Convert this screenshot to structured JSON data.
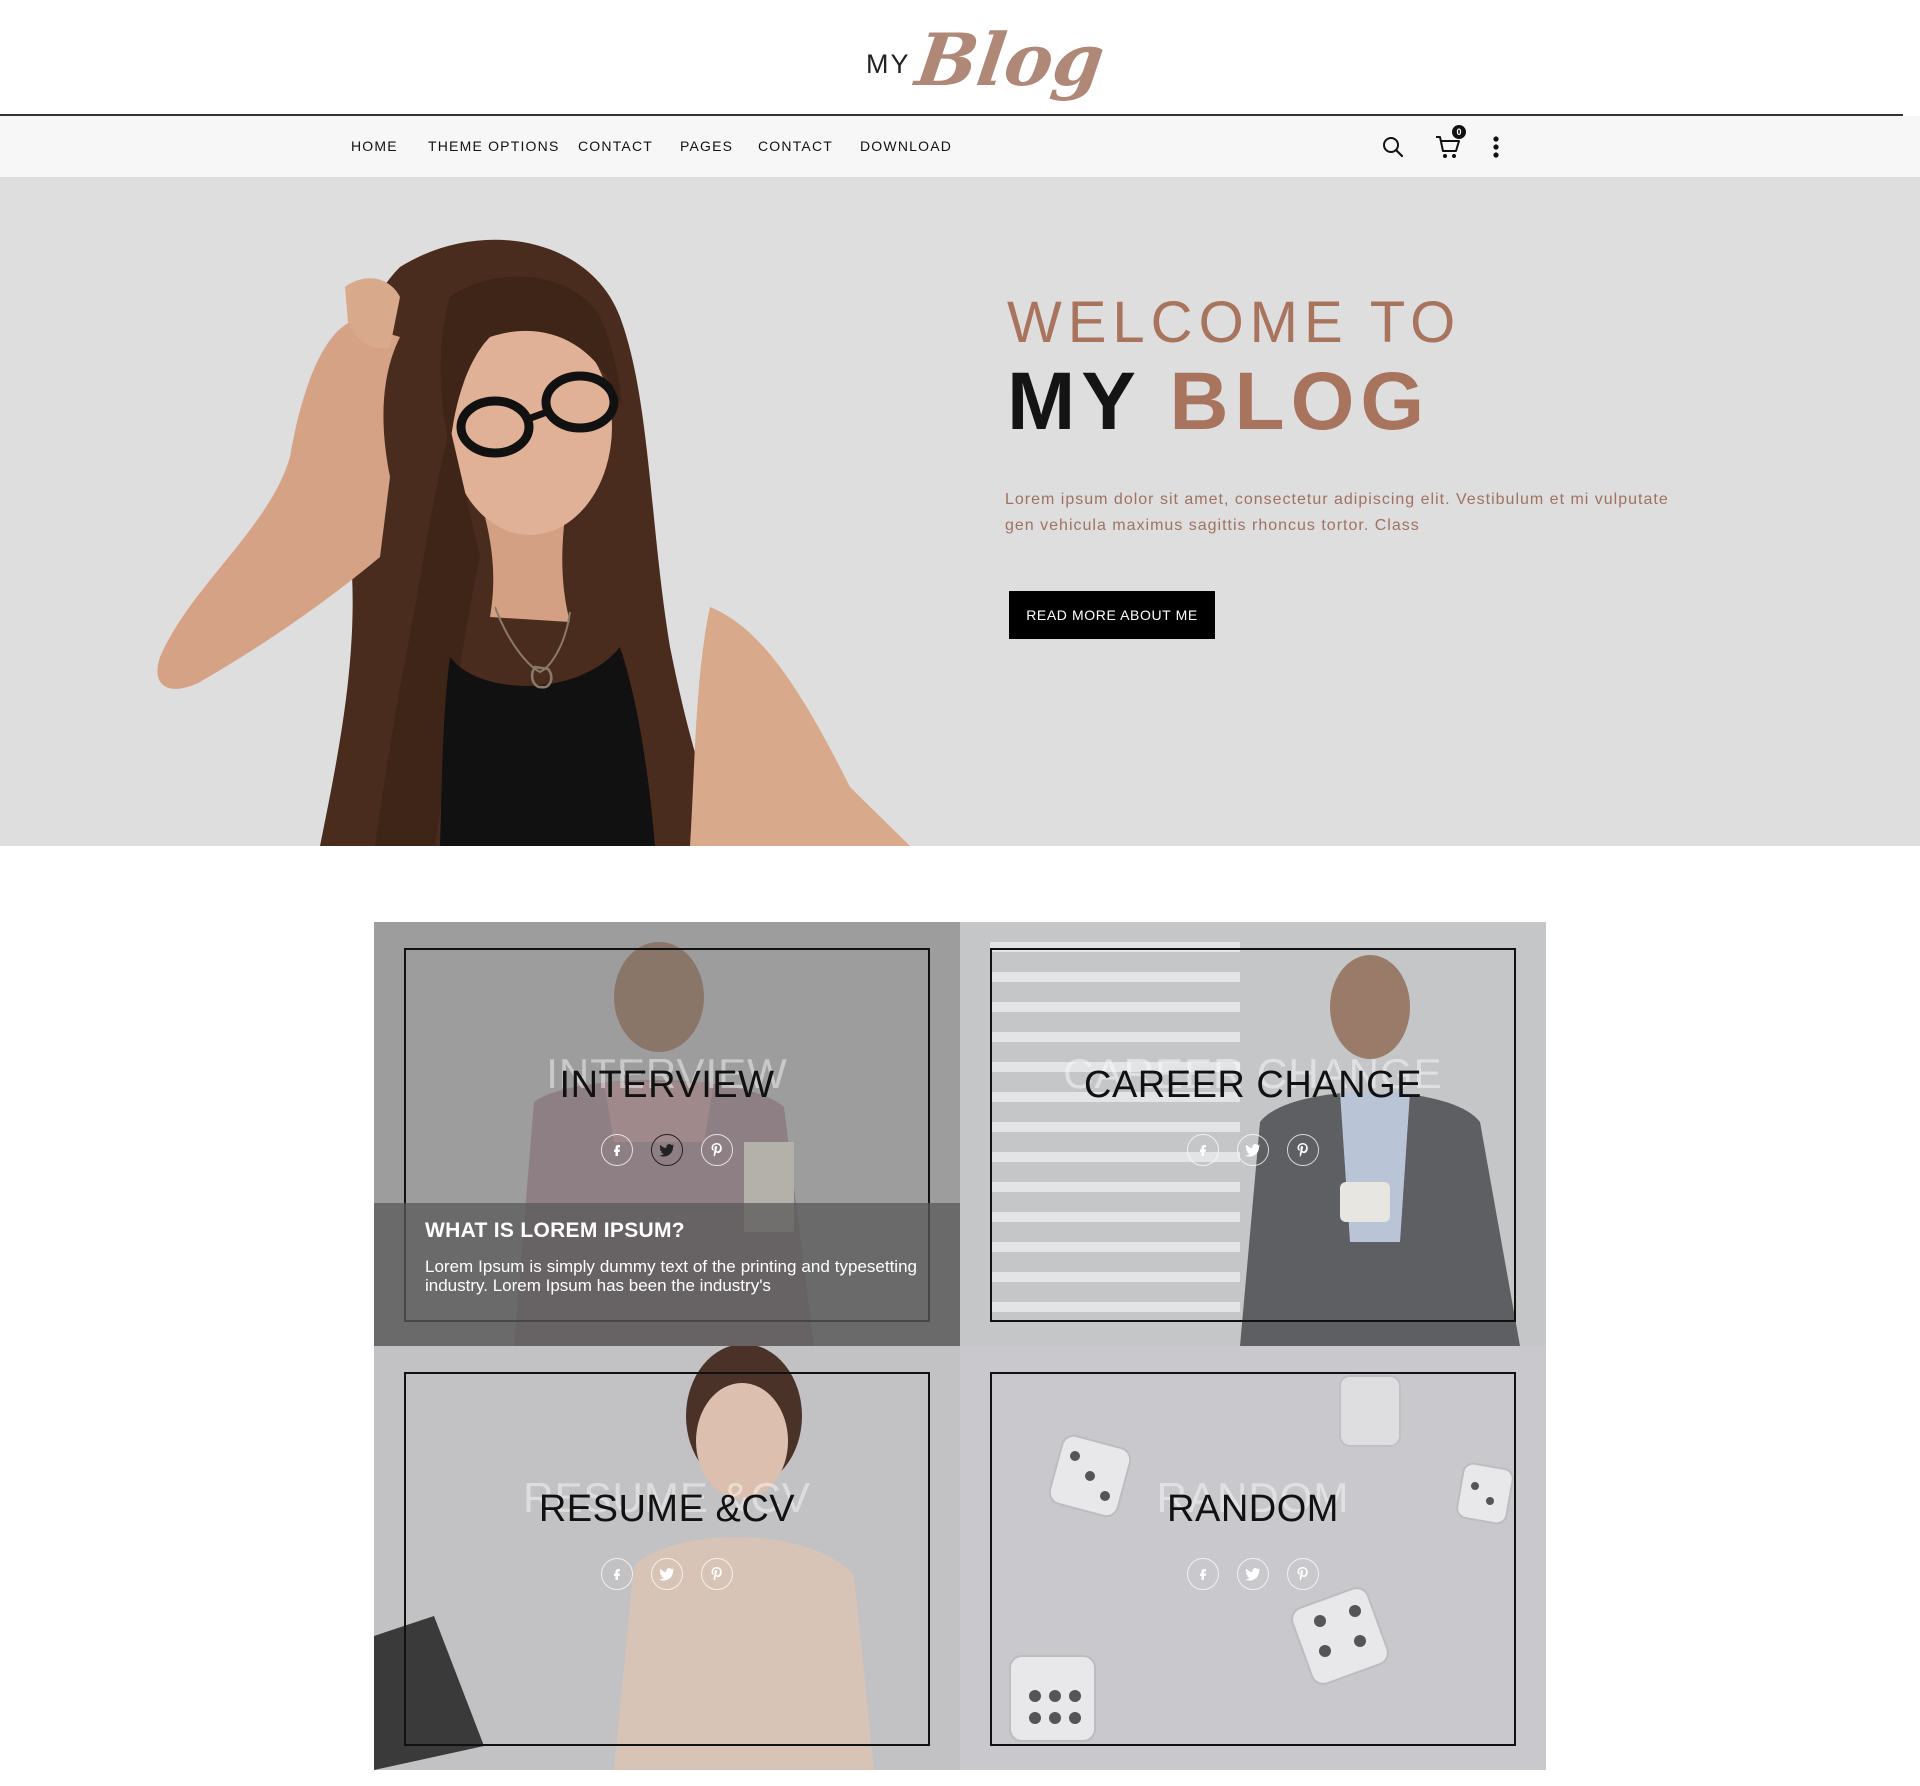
{
  "logo": {
    "prefix": "MY",
    "script": "Blog"
  },
  "nav": {
    "items": [
      "HOME",
      "THEME OPTIONS",
      "CONTACT",
      "PAGES",
      "CONTACT",
      "DOWNLOAD"
    ],
    "cart_count": "0"
  },
  "hero": {
    "welcome": "WELCOME TO",
    "title_dark": "MY",
    "title_accent": "BLOG",
    "description": "Lorem ipsum dolor sit amet, consectetur adipiscing elit. Vestibulum et mi vulputate gen vehicula maximus sagittis rhoncus tortor. Class",
    "button": "READ MORE ABOUT ME",
    "accent_color": "#a8745e"
  },
  "tiles": [
    {
      "ghost": "INTERVIEW",
      "title": "INTERVIEW",
      "overlay_title": "WHAT IS LOREM IPSUM?",
      "overlay_text": "Lorem Ipsum is simply dummy text of the printing and typesetting industry. Lorem Ipsum has been the industry's"
    },
    {
      "ghost": "CAREER CHANGE",
      "title": "CAREER CHANGE"
    },
    {
      "ghost": "RESUME &CV",
      "title": "RESUME &CV"
    },
    {
      "ghost": "RANDOM",
      "title": "RANDOM"
    }
  ],
  "icons": [
    "search-icon",
    "cart-icon",
    "more-vertical-icon",
    "facebook-icon",
    "twitter-icon",
    "pinterest-icon"
  ]
}
